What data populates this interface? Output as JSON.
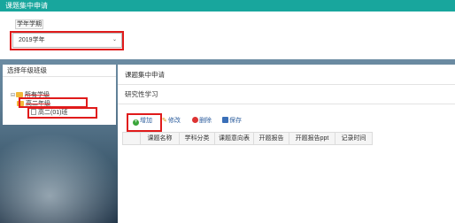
{
  "window": {
    "title": "课题集中申请"
  },
  "term": {
    "label": "学年学期",
    "selected": "2019学年"
  },
  "grade_panel": {
    "title": "选择年级班级",
    "tree": [
      "所有学级",
      "高二年级",
      "高二(01)班"
    ]
  },
  "main": {
    "header": "课题集中申请",
    "subheader": "研究性学习",
    "toolbar": {
      "add": "增加",
      "edit": "修改",
      "delete": "删除",
      "save": "保存"
    },
    "columns": [
      "课题名称",
      "学科分类",
      "课题意向表",
      "开题报告",
      "开题报告ppt",
      "记录时间"
    ]
  }
}
